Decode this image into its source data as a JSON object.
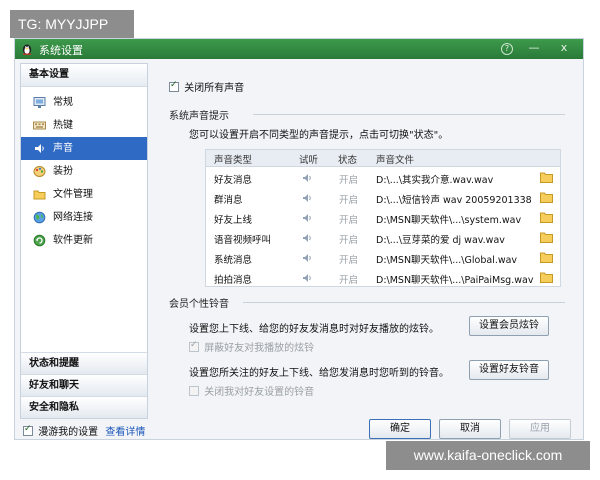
{
  "overlay": {
    "tag": "TG: MYYJJPP",
    "watermark": "www.kaifa-oneclick.com"
  },
  "window": {
    "title": "系统设置",
    "controls": {
      "help": "?",
      "minimize": "—",
      "close": "x"
    }
  },
  "sidebar": {
    "basic_header": "基本设置",
    "items": [
      {
        "label": "常规",
        "icon": "monitor-icon"
      },
      {
        "label": "热键",
        "icon": "keyboard-icon"
      },
      {
        "label": "声音",
        "icon": "speaker-icon",
        "active": true
      },
      {
        "label": "装扮",
        "icon": "palette-icon"
      },
      {
        "label": "文件管理",
        "icon": "folder-icon"
      },
      {
        "label": "网络连接",
        "icon": "globe-icon"
      },
      {
        "label": "软件更新",
        "icon": "update-icon"
      }
    ],
    "groups": [
      "状态和提醒",
      "好友和聊天",
      "安全和隐私"
    ]
  },
  "sound": {
    "mute_all_label": "关闭所有声音",
    "mute_all_checked": true,
    "system_section": "系统声音提示",
    "system_desc": "您可以设置开启不同类型的声音提示，点击可切换\"状态\"。",
    "columns": [
      "声音类型",
      "试听",
      "状态",
      "声音文件"
    ],
    "rows": [
      {
        "type": "好友消息",
        "status": "开启",
        "file": "D:\\...\\其实我介意.wav.wav"
      },
      {
        "type": "群消息",
        "status": "开启",
        "file": "D:\\...\\短信铃声 wav 20059201338"
      },
      {
        "type": "好友上线",
        "status": "开启",
        "file": "D:\\MSN聊天软件\\...\\system.wav"
      },
      {
        "type": "语音视频呼叫",
        "status": "开启",
        "file": "D:\\...\\豆芽菜的爱 dj wav.wav"
      },
      {
        "type": "系统消息",
        "status": "开启",
        "file": "D:\\MSN聊天软件\\...\\Global.wav"
      },
      {
        "type": "拍拍消息",
        "status": "开启",
        "file": "D:\\MSN聊天软件\\...\\PaiPaiMsg.wav"
      }
    ],
    "member_section": "会员个性铃音",
    "member_desc": "设置您上下线、给您的好友发消息时对好友播放的炫铃。",
    "member_button": "设置会员炫铃",
    "block_label": "屏蔽好友对我播放的炫铃",
    "friend_desc": "设置您所关注的好友上下线、给您发消息时您听到的铃音。",
    "friend_button": "设置好友铃音",
    "close_friend_label": "关闭我对好友设置的铃音"
  },
  "footer": {
    "roam_label": "漫游我的设置",
    "roam_checked": true,
    "details_link": "查看详情",
    "ok": "确定",
    "cancel": "取消",
    "apply": "应用"
  },
  "colors": {
    "titlebar": "#2f8a3e",
    "selection": "#2f6ac4",
    "link": "#1b56b8"
  }
}
